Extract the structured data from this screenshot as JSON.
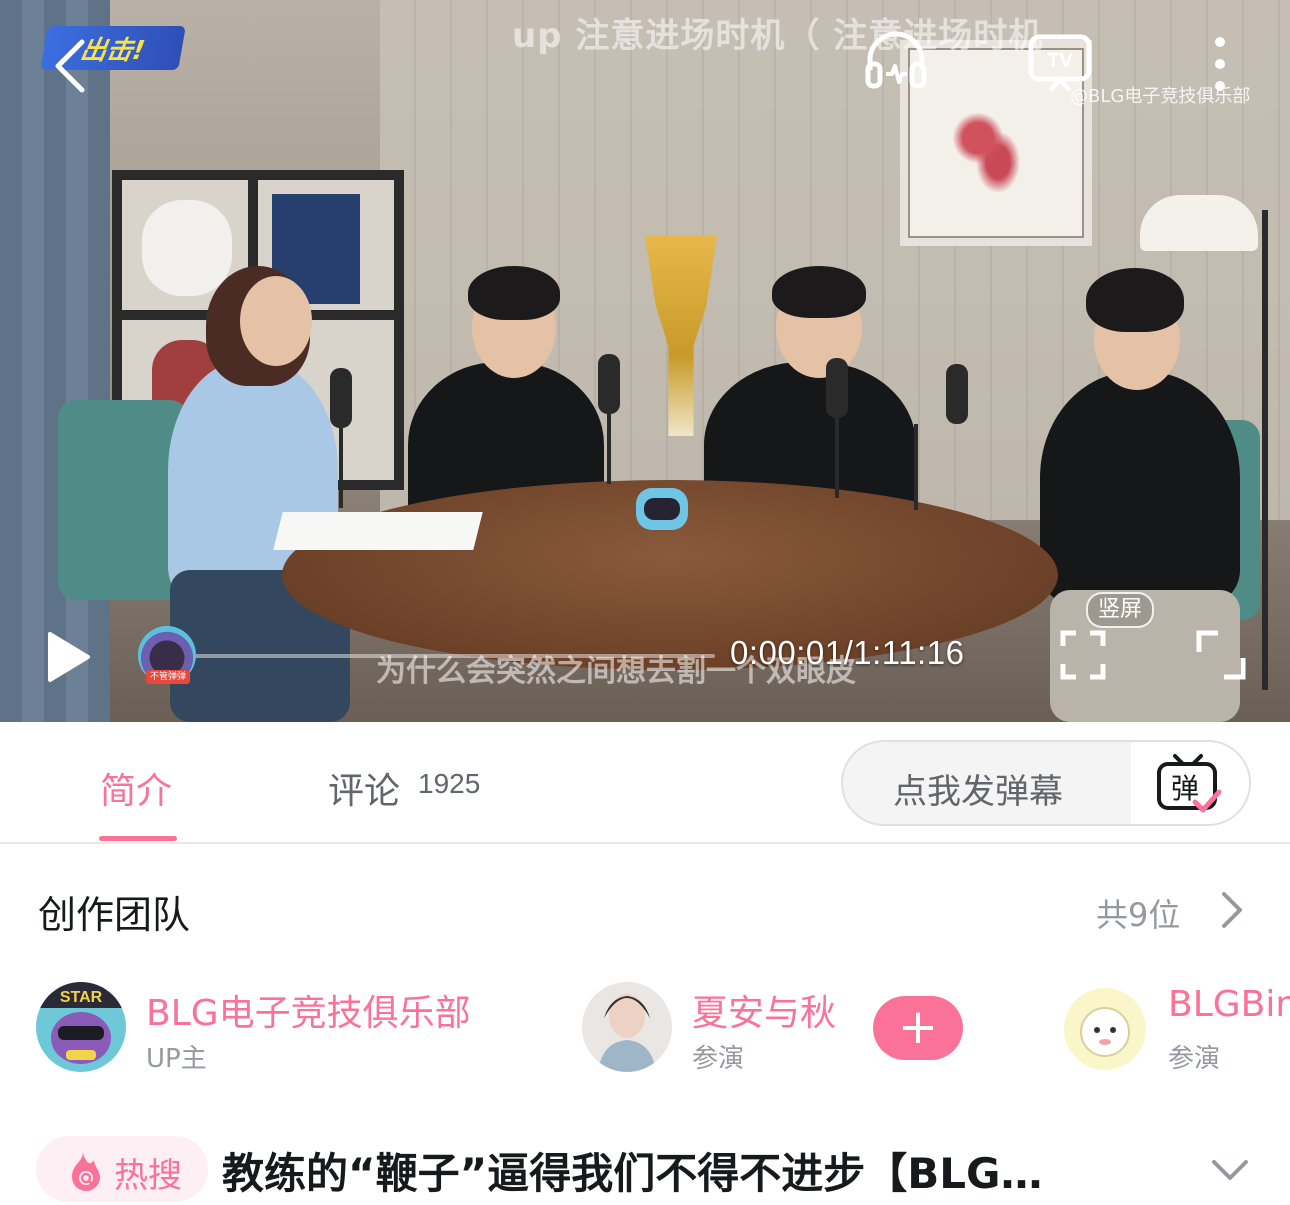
{
  "player": {
    "overlay_top_text": "up 注意进场时机（          注意进场时机",
    "watermark": "@BLG电子竞技俱乐部",
    "logo_text": "出击!",
    "subtitle": "为什么会突然之间想去割一个双眼皮",
    "time_display": "0:00:01/1:11:16",
    "progress_fraction": 0.0002,
    "vertical_badge": "竖屏",
    "scrubber_tag": "不管弹弹"
  },
  "tabs": {
    "intro": "简介",
    "comments": "评论",
    "comment_count": "1925",
    "danmaku_placeholder": "点我发弹幕",
    "danmaku_icon_char": "弹"
  },
  "team": {
    "title": "创作团队",
    "count": "共9位",
    "members": [
      {
        "name": "BLG电子竞技俱乐部",
        "role": "UP主"
      },
      {
        "name": "夏安与秋",
        "role": "参演"
      },
      {
        "name": "BLGBin",
        "role": "参演"
      }
    ],
    "follow_symbol": "+"
  },
  "hot": {
    "badge": "热搜",
    "title": "教练的“鞭子”逼得我们不得不进步【BLG…"
  },
  "colors": {
    "accent_pink": "#fb7299",
    "text_dark": "#18191c",
    "text_gray": "#9499a0"
  }
}
